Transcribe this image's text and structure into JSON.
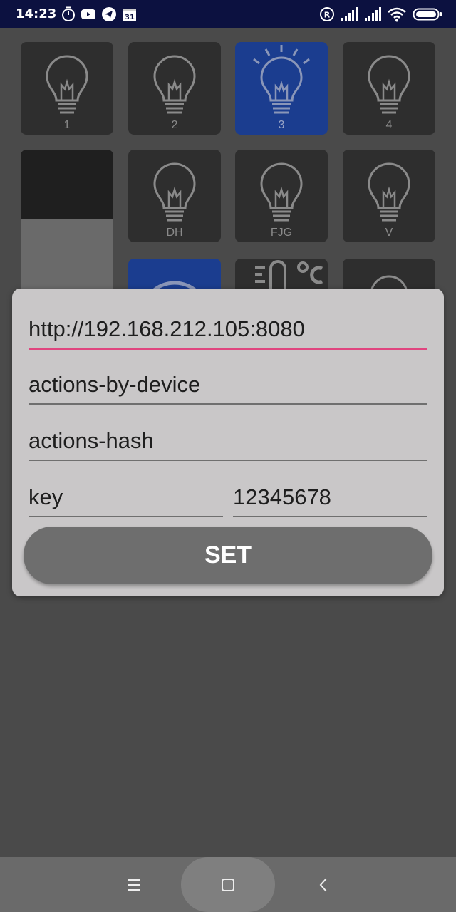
{
  "status_bar": {
    "time": "14:23",
    "calendar_day": "31",
    "icons": [
      "stopwatch-icon",
      "youtube-icon",
      "telegram-icon",
      "calendar-icon",
      "registered-icon",
      "signal-icon",
      "signal-icon",
      "wifi-icon",
      "battery-icon"
    ]
  },
  "tiles": [
    {
      "label": "1",
      "type": "bulb",
      "on": false
    },
    {
      "label": "2",
      "type": "bulb",
      "on": false
    },
    {
      "label": "3",
      "type": "bulb",
      "on": true
    },
    {
      "label": "4",
      "type": "bulb",
      "on": false
    },
    {
      "label": "DH",
      "type": "bulb",
      "on": false
    },
    {
      "label": "FJG",
      "type": "bulb",
      "on": false
    },
    {
      "label": "V",
      "type": "bulb",
      "on": false
    }
  ],
  "dialog": {
    "server_url": "http://192.168.212.105:8080",
    "actions_path": "actions-by-device",
    "hash_path": "actions-hash",
    "key_name": "key",
    "key_value": "12345678",
    "set_label": "SET"
  },
  "colors": {
    "status_bar": "#0c1140",
    "tile_off": "#2e2e2e",
    "tile_on": "#1b3d8f",
    "focus_underline": "#e0457f",
    "dialog_bg": "#c9c7c8",
    "button_bg": "#6e6e6e"
  },
  "nav_bar": {
    "icons": [
      "menu-icon",
      "home-icon",
      "back-icon"
    ]
  }
}
